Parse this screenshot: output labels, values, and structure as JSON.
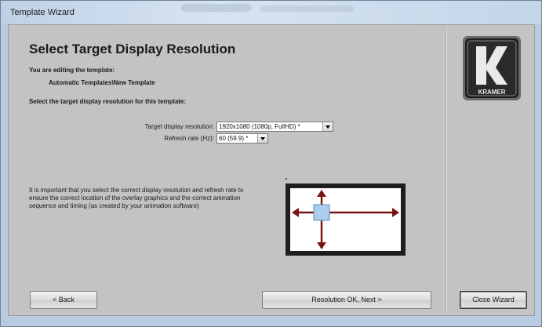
{
  "window": {
    "title": "Template Wizard"
  },
  "page": {
    "heading": "Select Target Display Resolution",
    "editing_label": "You are editing the template:",
    "template_path": "Automatic Templates\\New Template",
    "instruction": "Select the target display resolution for this template:"
  },
  "form": {
    "resolution_label": "Target display resolution:",
    "resolution_value": "1920x1080 (1080p, FullHD) *",
    "refresh_label": "Refresh rate (Hz):",
    "refresh_value": "60 (59.9) *"
  },
  "info": {
    "text": "It is important that you select the correct display resolution and refresh rate to ensure the correct location of the overlay graphics and the correct animation sequence and timing (as created by your animation software)"
  },
  "buttons": {
    "back": "< Back",
    "next": "Resolution OK, Next >",
    "close": "Close Wizard"
  },
  "logo": {
    "text": "KRAMER",
    "letter": "K"
  },
  "colors": {
    "panel": "#c3c3c3",
    "arrow": "#7a1414",
    "screen_fill": "#ffffff",
    "center_square": "#a9cdea"
  }
}
